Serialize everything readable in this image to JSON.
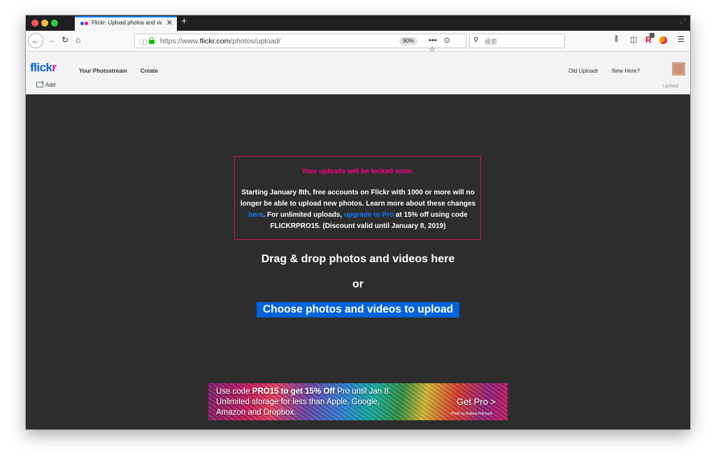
{
  "browser": {
    "tab_title": "Flickr: Upload photos and videos",
    "tab_close": "✕",
    "new_tab": "+",
    "url_prefix": "https://www.",
    "url_host": "flickr.com",
    "url_path": "/photos/upload/",
    "zoom": "90%",
    "page_actions": "•••",
    "search_placeholder": "検索",
    "icons": [
      "back-icon",
      "forward-icon",
      "reload-icon",
      "home-icon",
      "info-icon",
      "lock-icon",
      "pocket-icon",
      "bookmark-star-icon",
      "search-icon",
      "library-icon",
      "sidebar-icon",
      "extension-icon",
      "firefox-account-icon",
      "menu-icon"
    ]
  },
  "header": {
    "logo_main": "flick",
    "logo_accent": "r",
    "nav": {
      "photostream": "Your Photostream",
      "create": "Create",
      "old_uploadr": "Old Uploadr",
      "new_here": "New Here?"
    },
    "add_label": "Add",
    "upload_label": "Upload"
  },
  "notice": {
    "title": "Your uploads will be locked soon.",
    "body_1": "Starting January 8th, free accounts on Flickr with 1000 or more will no longer be able to upload new photos. Learn more about these changes ",
    "link_here": "here",
    "body_2": ". For unlimited uploads, ",
    "link_pro": "upgrade to Pro",
    "body_3": " at 15% off using code FLICKRPRO15. (Discount valid until January 8, 2019)"
  },
  "upload": {
    "drag_text": "Drag & drop photos and videos here",
    "or_text": "or",
    "choose_button": "Choose photos and videos to upload"
  },
  "promo": {
    "line1_pre": "Use code ",
    "line1_bold": "PRO15 to get 15% Off",
    "line1_post": " Pro until Jan 8.",
    "line2": "Unlimited storage for less than Apple, Google,",
    "line3": "Amazon and Dropbox.",
    "cta": "Get Pro >",
    "credit": "Photo by Anfissa Pritchard"
  },
  "colors": {
    "flickr_blue": "#0063dc",
    "flickr_pink": "#ff0084",
    "dark_bg": "#2d2d2d",
    "link_blue": "#0a7cff"
  }
}
